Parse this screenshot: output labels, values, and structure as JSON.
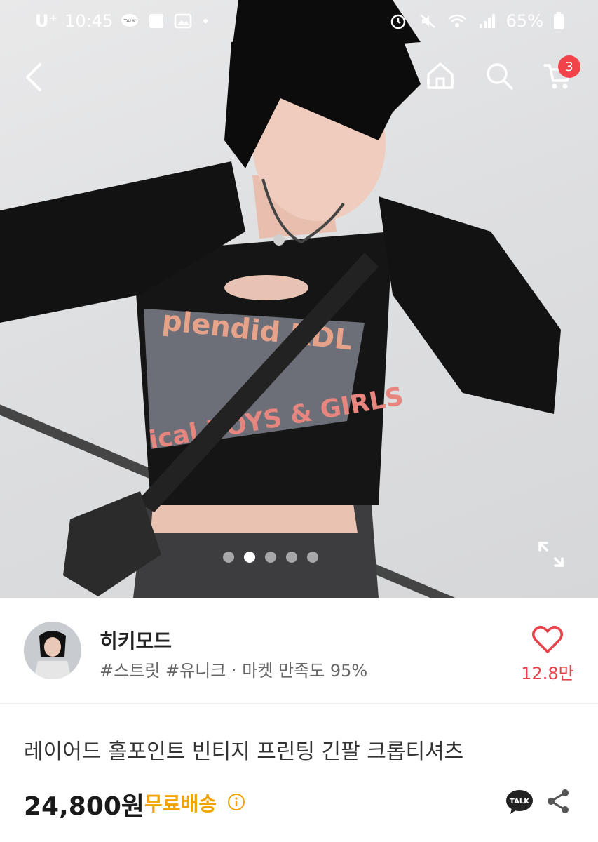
{
  "status_bar": {
    "carrier": "U⁺",
    "time": "10:45",
    "battery": "65%"
  },
  "nav": {
    "cart_count": "3"
  },
  "gallery": {
    "slide_count": 5,
    "active_index": 0
  },
  "product_image": {
    "print_text_1": "plendid KDL",
    "print_text_2": "ical BOYS & GIRLS"
  },
  "shop": {
    "name": "히키모드",
    "tags": "#스트릿 #유니크 · 마켓 만족도 95%",
    "likes": "12.8만"
  },
  "product": {
    "title": "레이어드 홀포인트 빈티지 프린팅 긴팔 크롭티셔츠",
    "price": "24,800원",
    "shipping": "무료배송",
    "talk_label": "TALK"
  },
  "colors": {
    "accent_red": "#e8434b",
    "badge_red": "#f0444a",
    "shipping_orange": "#f3a300"
  }
}
